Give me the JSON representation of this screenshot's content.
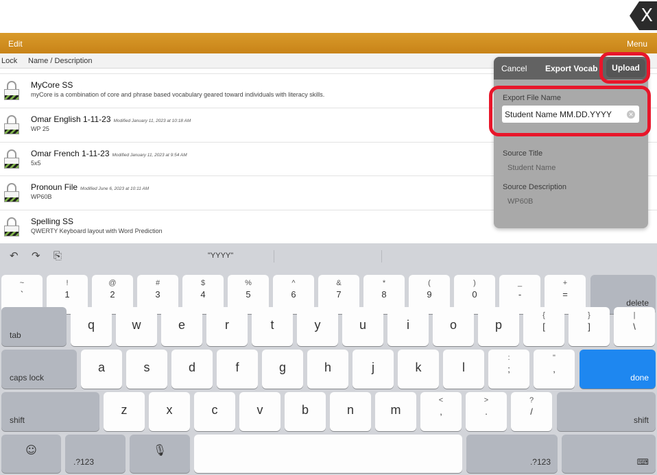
{
  "badge": {
    "glyph": "X"
  },
  "nav": {
    "edit": "Edit",
    "menu": "Menu"
  },
  "columns": {
    "lock": "Lock",
    "name": "Name / Description"
  },
  "rows": [
    {
      "title": "MyCore SS",
      "modified": "",
      "desc": "myCore is a combination of core and phrase based vocabulary geared toward individuals with literacy skills."
    },
    {
      "title": "Omar English 1-11-23",
      "modified": "Modified January 11, 2023 at 10:18 AM",
      "desc": "WP 25"
    },
    {
      "title": "Omar French 1-11-23",
      "modified": "Modified January 11, 2023 at 9:54 AM",
      "desc": "5x5"
    },
    {
      "title": "Pronoun File",
      "modified": "Modified June 6, 2023 at 10:11 AM",
      "desc": "WP60B"
    },
    {
      "title": "Spelling SS",
      "modified": "",
      "desc": "QWERTY Keyboard layout with Word Prediction"
    }
  ],
  "popover": {
    "cancel": "Cancel",
    "title": "Export Vocab",
    "upload": "Upload",
    "export_label": "Export File Name",
    "export_value": "Student Name MM.DD.YYYY",
    "source_title_label": "Source Title",
    "source_title_value": "Student Name",
    "source_desc_label": "Source Description",
    "source_desc_value": "WP60B"
  },
  "highlight_color": "#e8162a",
  "keyboard": {
    "suggestion": "\"YYYY\"",
    "tools": [
      "undo-icon",
      "redo-icon",
      "paste-icon"
    ],
    "row1": [
      {
        "t": "~",
        "b": "`"
      },
      {
        "t": "!",
        "b": "1"
      },
      {
        "t": "@",
        "b": "2"
      },
      {
        "t": "#",
        "b": "3"
      },
      {
        "t": "$",
        "b": "4"
      },
      {
        "t": "%",
        "b": "5"
      },
      {
        "t": "^",
        "b": "6"
      },
      {
        "t": "&",
        "b": "7"
      },
      {
        "t": "*",
        "b": "8"
      },
      {
        "t": "(",
        "b": "9"
      },
      {
        "t": ")",
        "b": "0"
      },
      {
        "t": "_",
        "b": "-"
      },
      {
        "t": "+",
        "b": "="
      }
    ],
    "delete": "delete",
    "tab": "tab",
    "row2": [
      "q",
      "w",
      "e",
      "r",
      "t",
      "y",
      "u",
      "i",
      "o",
      "p"
    ],
    "row2_extra": [
      {
        "t": "{",
        "b": "["
      },
      {
        "t": "}",
        "b": "]"
      },
      {
        "t": "|",
        "b": "\\"
      }
    ],
    "caps": "caps lock",
    "row3": [
      "a",
      "s",
      "d",
      "f",
      "g",
      "h",
      "j",
      "k",
      "l"
    ],
    "row3_extra": [
      {
        "t": ":",
        "b": ";"
      },
      {
        "t": "\"",
        "b": ","
      }
    ],
    "done": "done",
    "shift": "shift",
    "row4": [
      "z",
      "x",
      "c",
      "v",
      "b",
      "n",
      "m"
    ],
    "row4_extra": [
      {
        "t": "<",
        "b": ","
      },
      {
        "t": ">",
        "b": "."
      },
      {
        "t": "?",
        "b": "/"
      }
    ],
    "numbers": ".?123",
    "accent": "#1e87f0"
  }
}
